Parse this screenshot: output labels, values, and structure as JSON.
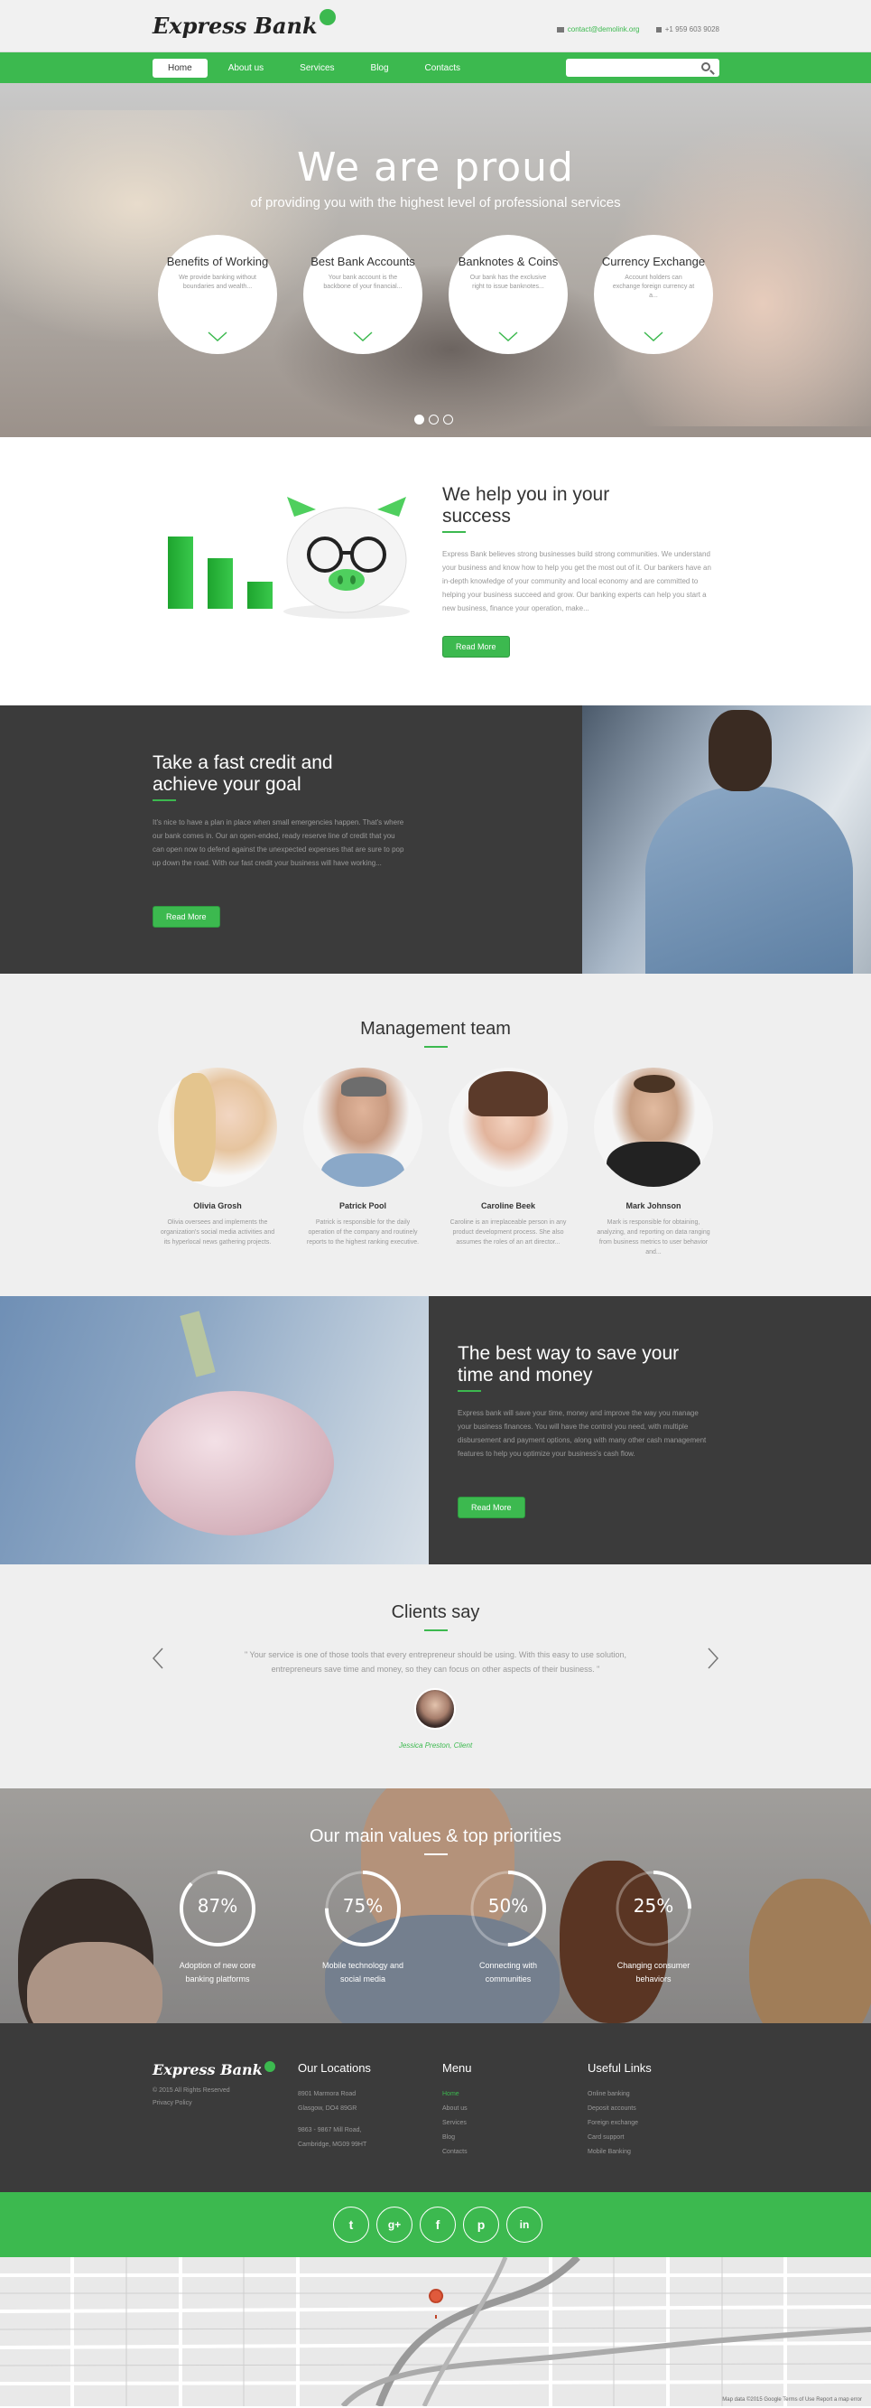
{
  "header": {
    "logo": "Express Bank",
    "email": "contact@demolink.org",
    "phone": "+1 959 603 9028"
  },
  "nav": {
    "items": [
      "Home",
      "About us",
      "Services",
      "Blog",
      "Contacts"
    ],
    "active": "Home",
    "search_placeholder": ""
  },
  "hero": {
    "title": "We are proud",
    "subtitle": "of providing you with the highest level of professional services",
    "cards": [
      {
        "title": "Benefits of Working",
        "text": "We provide banking without boundaries and wealth..."
      },
      {
        "title": "Best Bank Accounts",
        "text": "Your bank account is the backbone of your financial..."
      },
      {
        "title": "Banknotes & Coins",
        "text": "Our bank has the exclusive right to issue banknotes..."
      },
      {
        "title": "Currency Exchange",
        "text": "Account holders can exchange foreign currency at a..."
      }
    ],
    "slides_active": 1
  },
  "help": {
    "title": "We help you in your success",
    "text": "Express Bank believes strong businesses build strong communities. We understand your business and know how to help you get the most out of it. Our bankers have an in-depth knowledge of your community and local economy and are committed to helping your business succeed and grow. Our banking experts can help you start a new business, finance your operation, make...",
    "button": "Read More"
  },
  "credit": {
    "title": "Take a fast credit and achieve your goal",
    "text": "It's nice to have a plan in place when small emergencies happen. That's where our bank comes in. Our an open-ended, ready reserve line of credit that you can open now to defend against the unexpected expenses that are sure to pop up down the road. With our fast credit your business will have working...",
    "button": "Read More"
  },
  "team": {
    "title": "Management team",
    "members": [
      {
        "name": "Olivia Grosh",
        "text": "Olivia oversees and implements the organization's social media activities and its hyperlocal news gathering projects."
      },
      {
        "name": "Patrick Pool",
        "text": "Patrick is responsible for the daily operation of the company and routinely reports to the highest ranking executive."
      },
      {
        "name": "Caroline Beek",
        "text": "Caroline is an irreplaceable person in any product development process. She also assumes the roles of an art director..."
      },
      {
        "name": "Mark Johnson",
        "text": "Mark is responsible for obtaining, analyzing, and reporting on data ranging from business metrics to user behavior and..."
      }
    ]
  },
  "save": {
    "title": "The best way to save your time and money",
    "text": "Express bank will save your time, money and improve the way you manage your business finances. You will have the control you need, with multiple disbursement and payment options, along with many other cash management features to help you optimize your business's cash flow.",
    "button": "Read More"
  },
  "clients": {
    "title": "Clients say",
    "quote": "\" Your service is one of those tools that every entrepreneur should be using. With this easy to use solution, entrepreneurs save time and money, so they can focus on other aspects of their business. \"",
    "author": "Jessica Preston, Client"
  },
  "values": {
    "title": "Our main values & top priorities",
    "items": [
      {
        "percent": 87,
        "label": "87%",
        "text": "Adoption of new core banking platforms"
      },
      {
        "percent": 75,
        "label": "75%",
        "text": "Mobile technology and social media"
      },
      {
        "percent": 50,
        "label": "50%",
        "text": "Connecting with communities"
      },
      {
        "percent": 25,
        "label": "25%",
        "text": "Changing consumer behaviors"
      }
    ]
  },
  "footer": {
    "logo": "Express Bank",
    "copyright": "© 2015 All Rights Reserved",
    "privacy": "Privacy Policy",
    "locations_title": "Our Locations",
    "location1_line1": "8901 Marmora Road",
    "location1_line2": "Glasgow, DO4 89GR",
    "location2_line1": "9863 - 9867 Mill Road,",
    "location2_line2": "Cambridge, MG09 99HT",
    "menu_title": "Menu",
    "menu": [
      "Home",
      "About us",
      "Services",
      "Blog",
      "Contacts"
    ],
    "links_title": "Useful Links",
    "links": [
      "Online banking",
      "Deposit accounts",
      "Foreign exchange",
      "Card support",
      "Mobile Banking"
    ]
  },
  "social": [
    "twitter-icon",
    "google-plus-icon",
    "facebook-icon",
    "pinterest-icon",
    "linkedin-icon"
  ],
  "social_glyphs": [
    "t",
    "g+",
    "f",
    "p",
    "in"
  ],
  "map": {
    "footer": "Map data ©2015 Google   Terms of Use   Report a map error"
  },
  "colors": {
    "accent": "#3cb94f",
    "dark": "#3b3b3b",
    "light": "#efefef"
  }
}
